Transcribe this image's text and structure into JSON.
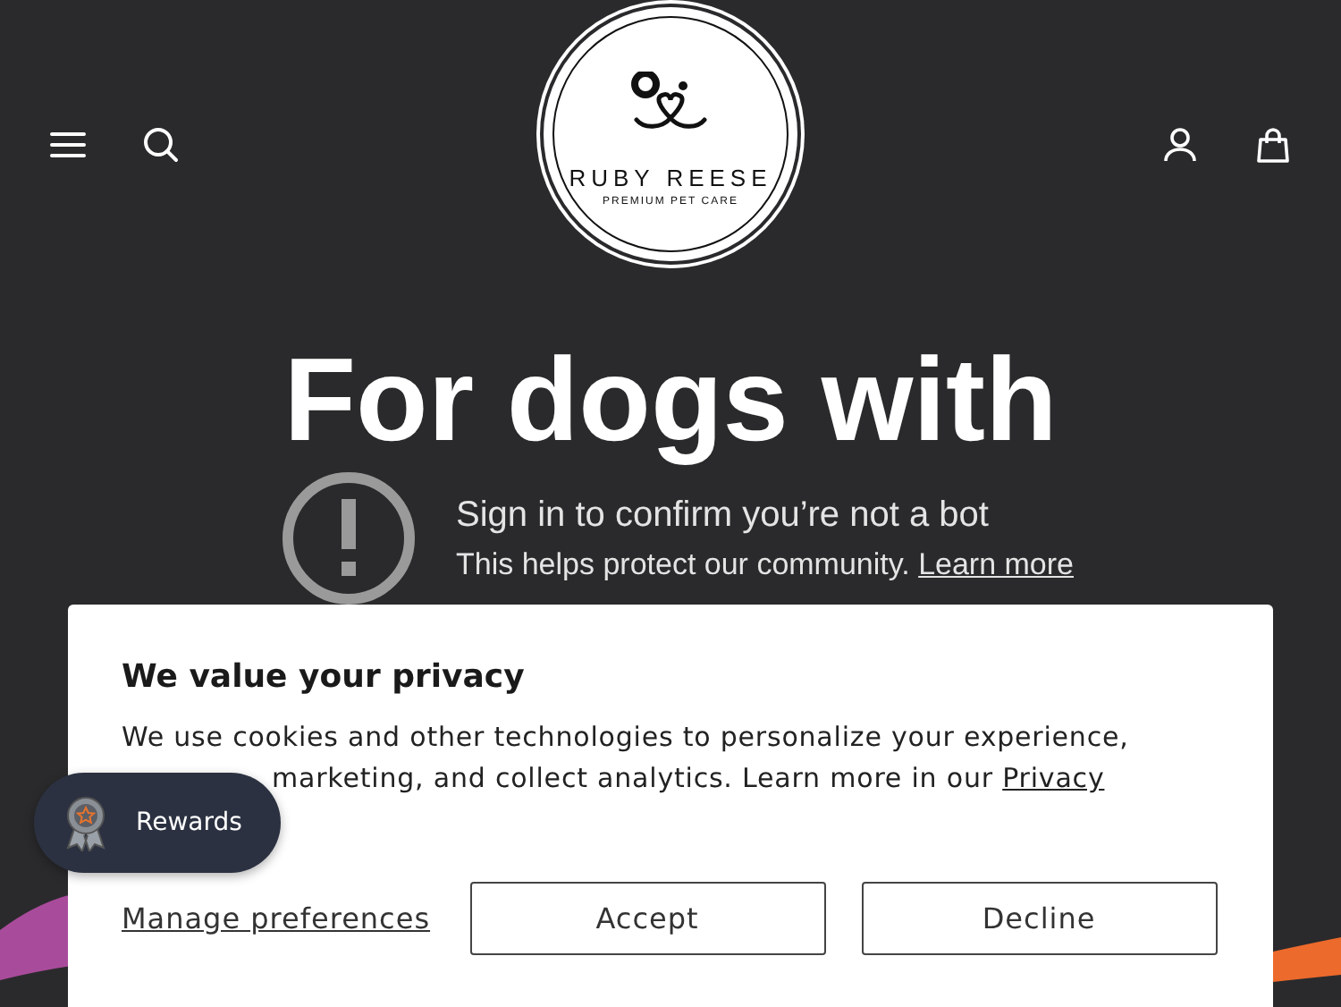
{
  "header": {
    "logo": {
      "name": "RUBY REESE",
      "tagline": "PREMIUM PET CARE"
    }
  },
  "hero": {
    "title_lines": [
      "For dogs with"
    ]
  },
  "bot_notice": {
    "title": "Sign in to confirm you’re not a bot",
    "text": "This helps protect our community.",
    "link": "Learn more"
  },
  "privacy": {
    "title": "We value your privacy",
    "lines": [
      "We use cookies and other technologies to personalize your experience,",
      "marketing, and collect analytics. Learn more in our"
    ],
    "link": "Privacy",
    "manage": "Manage preferences",
    "buttons": [
      "Accept",
      "Decline"
    ]
  },
  "rewards": {
    "label": "Rewards"
  }
}
